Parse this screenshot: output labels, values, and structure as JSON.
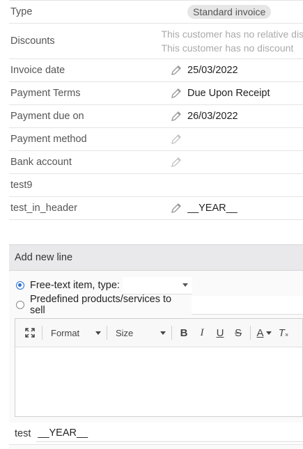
{
  "properties": [
    {
      "label": "Type",
      "value": "Standard invoice"
    },
    {
      "label": "Discounts",
      "line1": "This customer has no relative discount",
      "line2": "This customer has no discount"
    },
    {
      "label": "Invoice date",
      "value": "25/03/2022"
    },
    {
      "label": "Payment Terms",
      "value": "Due Upon Receipt"
    },
    {
      "label": "Payment due on",
      "value": "26/03/2022"
    },
    {
      "label": "Payment method",
      "value": ""
    },
    {
      "label": "Bank account",
      "value": ""
    },
    {
      "label": "test9",
      "value": ""
    },
    {
      "label": "test_in_header",
      "value": "__YEAR__"
    }
  ],
  "add_line": {
    "title": "Add new line",
    "free_text_label": "Free-text item, type:",
    "free_text_type": "",
    "predefined_label": "Predefined products/services to sell",
    "toolbar": {
      "format": "Format",
      "size": "Size",
      "bold": "B",
      "italic": "I",
      "underline": "U",
      "strike": "S",
      "text_color": "A",
      "clear": "T"
    },
    "extra_label": "test",
    "extra_value": "__YEAR__"
  },
  "colors": {
    "accent": "#2a6fd6",
    "pill_bg": "#e6e6e6",
    "header_bg": "#e9e9eb"
  }
}
